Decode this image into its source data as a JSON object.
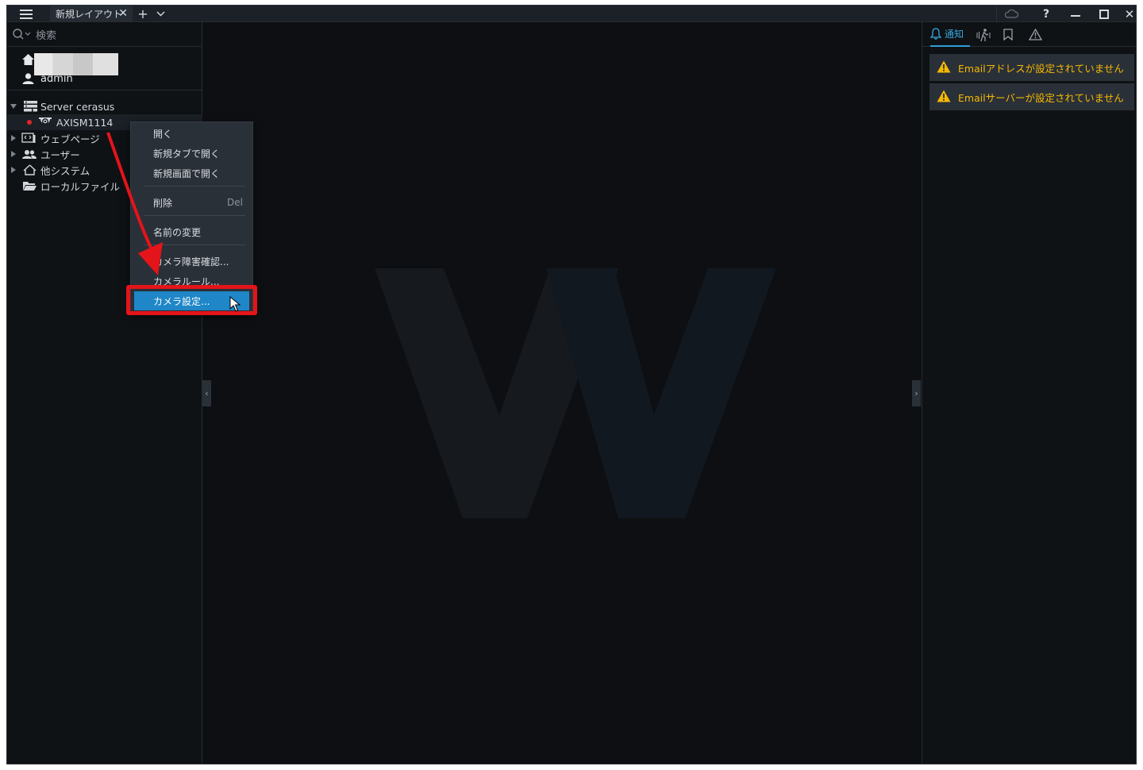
{
  "titlebar": {
    "tab_label": "新規レイアウト",
    "tab_close": "✕",
    "add_tab": "+",
    "help": "?",
    "close": "✕"
  },
  "search": {
    "placeholder": "検索"
  },
  "user": {
    "name": "admin"
  },
  "tree": {
    "server": "Server cerasus",
    "camera": "AXISM1114",
    "web_pages": "ウェブページ",
    "users": "ユーザー",
    "other_systems": "他システム",
    "local_files": "ローカルファイル"
  },
  "notifications": {
    "tab_label": "通知",
    "items": [
      "Emailアドレスが設定されていません",
      "Emailサーバーが設定されていません"
    ]
  },
  "context_menu": {
    "open": "開く",
    "open_new_tab": "新規タブで開く",
    "open_new_window": "新規画面で開く",
    "delete": "削除",
    "delete_shortcut": "Del",
    "rename": "名前の変更",
    "camera_issue": "カメラ障害確認...",
    "camera_rules": "カメラルール...",
    "camera_settings": "カメラ設定..."
  },
  "colors": {
    "accent": "#2f9fd8",
    "warning": "#f5b800",
    "highlight_box": "#e3141a",
    "camera_status": "#e0262a"
  }
}
